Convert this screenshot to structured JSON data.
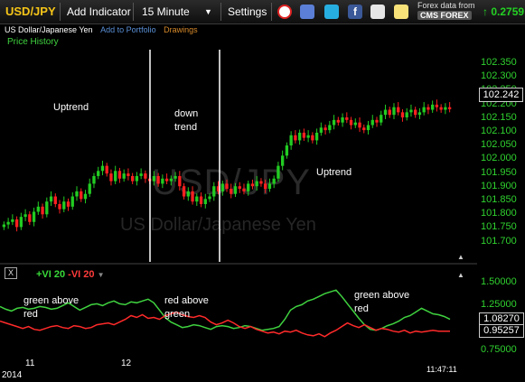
{
  "toolbar": {
    "symbol": "USD/JPY",
    "add_indicator": "Add Indicator",
    "interval": "15 Minute",
    "settings": "Settings",
    "forex_line1": "Forex data from",
    "forex_line2": "CMS FOREX",
    "quote": "↑ 0.2759"
  },
  "header": {
    "instrument_name": "US Dollar/Japanese Yen",
    "add_to_portfolio": "Add to Portfolio",
    "drawings": "Drawings",
    "price_history": "Price History"
  },
  "watermark": {
    "symbol": "USD/JPY",
    "name": "US Dollar/Japanese Yen"
  },
  "annotations": {
    "uptrend_left": "Uptrend",
    "down_trend": [
      "down",
      "trend"
    ],
    "uptrend_right": "Uptrend",
    "green_above_red_left": [
      "green above",
      "red"
    ],
    "red_above_green": [
      "red above",
      "green"
    ],
    "green_above_red_right": [
      "green above",
      "red"
    ]
  },
  "price_axis": {
    "ticks": [
      "102.350",
      "102.300",
      "102.250",
      "102.200",
      "102.150",
      "102.100",
      "102.050",
      "102.000",
      "101.950",
      "101.900",
      "101.850",
      "101.800",
      "101.750",
      "101.700"
    ],
    "current": "102.242"
  },
  "indicator": {
    "plus_label": "+VI 20",
    "minus_label": "-VI 20",
    "ticks": [
      "1.50000",
      "1.25000",
      "1.00000",
      "0.75000"
    ],
    "plus_value": "1.08270",
    "minus_value": "0.95257"
  },
  "time_axis": {
    "labels": [
      "11",
      "12"
    ],
    "year": "2014",
    "last_time": "11:47:11"
  },
  "colors": {
    "up": "#22cc22",
    "down": "#ff2020",
    "plus_vi": "#3fd23f",
    "minus_vi": "#ff2a2a",
    "axis_text": "#2fd12f"
  },
  "chart_data": [
    {
      "type": "candlestick",
      "ylim": [
        101.7,
        102.38
      ],
      "close": [
        101.79,
        101.8,
        101.81,
        101.78,
        101.82,
        101.83,
        101.8,
        101.84,
        101.86,
        101.83,
        101.88,
        101.9,
        101.87,
        101.85,
        101.88,
        101.86,
        101.9,
        101.92,
        101.89,
        101.91,
        101.95,
        101.98,
        102.0,
        102.02,
        101.99,
        101.96,
        102.0,
        101.97,
        101.99,
        101.98,
        101.96,
        101.98,
        101.99,
        101.97,
        101.96,
        101.98,
        101.95,
        101.97,
        101.96,
        101.97,
        101.98,
        101.94,
        101.9,
        101.92,
        101.88,
        101.9,
        101.87,
        101.89,
        101.9,
        101.94,
        101.92,
        101.95,
        101.93,
        101.91,
        101.94,
        101.93,
        101.92,
        101.95,
        101.94,
        101.96,
        101.95,
        101.93,
        101.95,
        101.97,
        102.02,
        102.06,
        102.1,
        102.14,
        102.12,
        102.15,
        102.13,
        102.14,
        102.12,
        102.15,
        102.17,
        102.16,
        102.18,
        102.2,
        102.19,
        102.21,
        102.2,
        102.18,
        102.19,
        102.17,
        102.16,
        102.18,
        102.2,
        102.19,
        102.22,
        102.24,
        102.22,
        102.25,
        102.23,
        102.21,
        102.23,
        102.24,
        102.22,
        102.23,
        102.25,
        102.24,
        102.26,
        102.25,
        102.24,
        102.25,
        102.242
      ]
    },
    {
      "type": "line",
      "series": [
        {
          "name": "+VI 20",
          "values": [
            1.22,
            1.19,
            1.17,
            1.2,
            1.21,
            1.19,
            1.2,
            1.22,
            1.21,
            1.19,
            1.2,
            1.23,
            1.26,
            1.22,
            1.18,
            1.21,
            1.24,
            1.25,
            1.23,
            1.26,
            1.28,
            1.25,
            1.24,
            1.27,
            1.26,
            1.28,
            1.3,
            1.26,
            1.18,
            1.1,
            1.05,
            1.02,
            0.99,
            1.0,
            1.02,
            1.01,
            0.99,
            0.97,
            1.0,
            1.01,
            1.0,
            0.98,
            0.99,
            1.01,
            1.0,
            0.98,
            0.96,
            0.97,
            0.98,
            1.0,
            1.08,
            1.18,
            1.22,
            1.24,
            1.28,
            1.3,
            1.33,
            1.36,
            1.38,
            1.4,
            1.33,
            1.25,
            1.17,
            1.09,
            1.02,
            0.97,
            0.96,
            0.98,
            1.01,
            1.03,
            1.06,
            1.1,
            1.12,
            1.16,
            1.2,
            1.17,
            1.14,
            1.13,
            1.11,
            1.08
          ]
        },
        {
          "name": "-VI 20",
          "values": [
            1.06,
            1.04,
            1.02,
            1.0,
            0.98,
            1.0,
            0.97,
            0.96,
            0.98,
            1.0,
            1.01,
            0.99,
            0.98,
            1.01,
            1.0,
            0.98,
            0.99,
            1.02,
            1.03,
            1.04,
            1.02,
            1.05,
            1.08,
            1.12,
            1.1,
            1.13,
            1.09,
            1.1,
            1.08,
            1.12,
            1.14,
            1.16,
            1.13,
            1.11,
            1.1,
            1.12,
            1.1,
            1.05,
            1.02,
            1.04,
            1.07,
            1.04,
            1.0,
            0.98,
            1.0,
            0.97,
            0.95,
            0.93,
            0.94,
            0.92,
            0.95,
            0.94,
            0.96,
            0.93,
            0.91,
            0.9,
            0.92,
            0.89,
            0.93,
            0.96,
            1.0,
            1.04,
            1.01,
            0.99,
            1.02,
            0.99,
            0.96,
            0.98,
            0.97,
            0.95,
            0.94,
            0.96,
            0.93,
            0.95,
            0.94,
            0.95,
            0.96,
            0.95,
            0.95,
            0.95
          ]
        }
      ],
      "ylim": [
        0.7,
        1.55
      ]
    }
  ]
}
